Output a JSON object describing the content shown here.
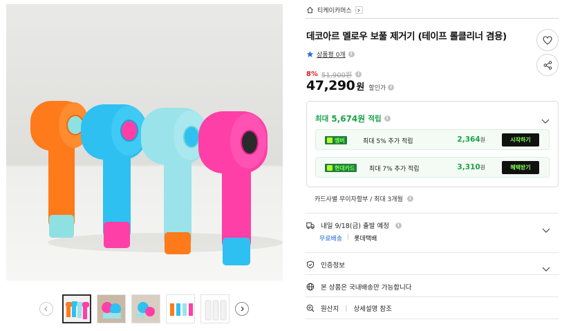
{
  "breadcrumb": {
    "store": "티케이카머스"
  },
  "product": {
    "title": "데코아르 멜로우 보풀 제거기 (테이프 롤클리너 겸용)",
    "rating_text": "상품평 0개"
  },
  "price": {
    "discount_rate": "8%",
    "original_price": "51,900원",
    "sale_price": "47,290",
    "sale_unit": "원",
    "sale_label": "할인가"
  },
  "rewards": {
    "header_prefix": "최대",
    "header_amount": "5,674원",
    "header_suffix": "적립",
    "items": [
      {
        "badge": "멤버",
        "desc": "최대 5% 추가 적립",
        "value": "2,364",
        "unit": "원",
        "cta": "시작하기"
      },
      {
        "badge": "현대카드",
        "desc": "최대 7% 추가 적립",
        "value": "3,310",
        "unit": "원",
        "cta": "혜택받기"
      }
    ]
  },
  "installment": "카드사별 무이자할부 / 최대 3개월",
  "shipping": {
    "text": "내일 9/18(금) 출발 예정",
    "fee": "무료배송",
    "courier": "롯데택배"
  },
  "certification": "인증정보",
  "domestic": "본 상품은 국내배송만 가능합니다",
  "origin": {
    "label": "원산지",
    "value": "상세설명 참조"
  },
  "colors": {
    "discount": "#e02020",
    "reward_green": "#1aa24a",
    "link_blue": "#1967d2",
    "badge_lime": "#7cff4f"
  },
  "icons": [
    "home-icon",
    "chevron-right-icon",
    "heart-icon",
    "share-icon",
    "star-icon",
    "info-icon",
    "chevron-down-icon",
    "truck-icon",
    "shield-icon",
    "globe-icon",
    "search-doc-icon",
    "arrow-left-icon",
    "arrow-right-icon"
  ]
}
